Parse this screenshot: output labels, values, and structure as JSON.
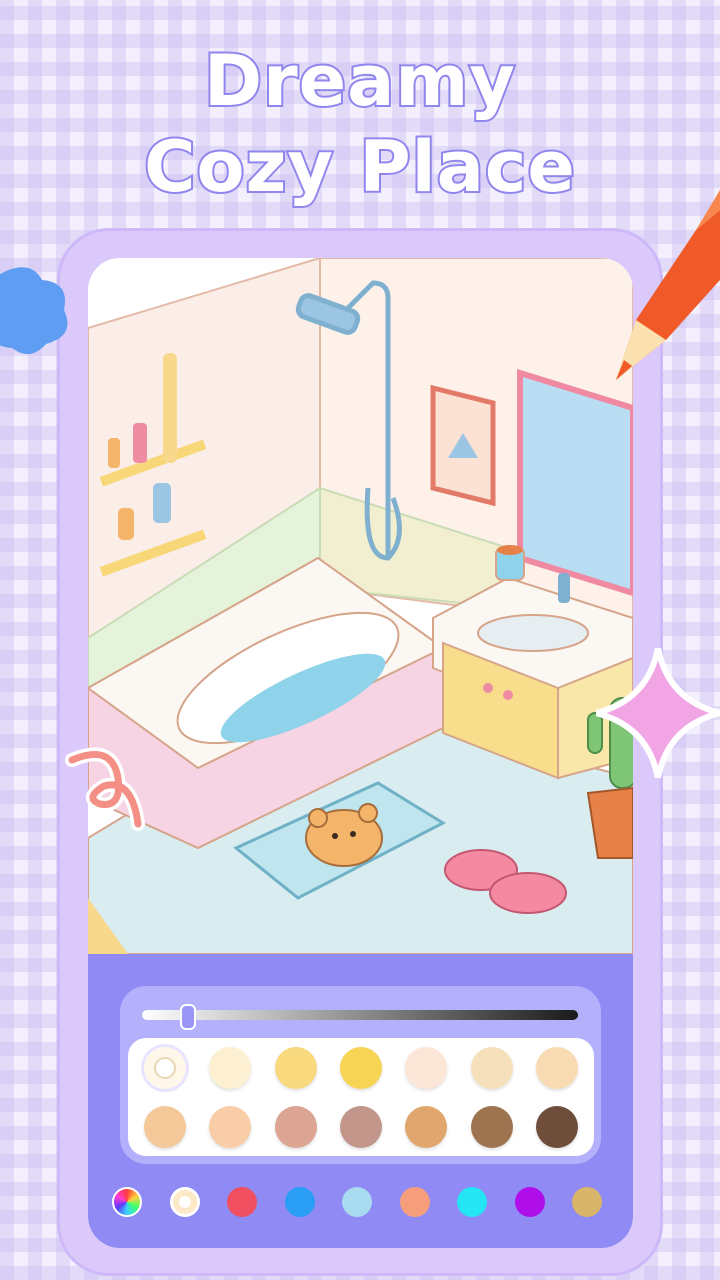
{
  "headline": {
    "line1": "Dreamy",
    "line2": "Cozy Place"
  },
  "colors": {
    "background": "#f3effd",
    "frame": "#dcc9fb",
    "panel": "#8f8af4",
    "accent": "#8f86ee"
  },
  "canvas": {
    "scene": "isometric bathroom illustration",
    "icons": [
      "shower-icon",
      "bathtub-icon",
      "bear-bathmat-icon",
      "slippers-icon",
      "cactus-icon",
      "mirror-icon",
      "picture-frame-icon",
      "shelf-icon",
      "sink-icon",
      "mug-icon"
    ]
  },
  "brightness_slider": {
    "value": 0.1
  },
  "swatches": [
    "#fff8ea",
    "#fdf0d2",
    "#f9d97e",
    "#f8d454",
    "#fce6d8",
    "#f6dfbb",
    "#f9dbb3",
    "#f5c89a",
    "#f8cda7",
    "#dba493",
    "#c2968a",
    "#e0a66d",
    "#9d7350",
    "#6e4d3a"
  ],
  "palettes": [
    "#rainbow",
    "#fde8c8",
    "#ef4f5e",
    "#2a9df4",
    "#a9dbf0",
    "#f69d7c",
    "#23e6f2",
    "#b00ee8",
    "#d8b56b"
  ],
  "decorations": [
    "blue-blob-icon",
    "pencil-icon",
    "pink-sparkle-icon",
    "squiggle-icon"
  ]
}
